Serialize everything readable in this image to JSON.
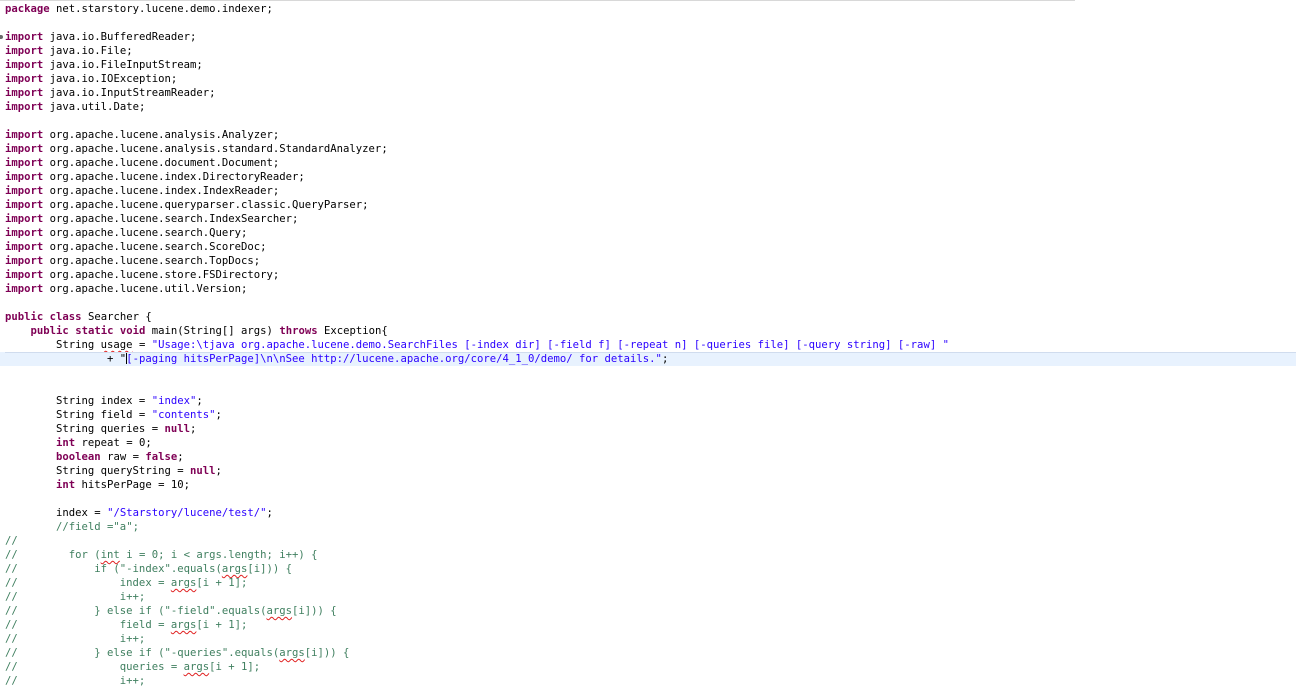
{
  "editor": {
    "lines": [
      {
        "folded": false,
        "tokens": [
          {
            "k": "kw",
            "t": "package"
          },
          {
            "k": "",
            "t": " net.starstory.lucene.demo.indexer;"
          }
        ]
      },
      {
        "tokens": []
      },
      {
        "folded": true,
        "tokens": [
          {
            "k": "kw",
            "t": "import"
          },
          {
            "k": "",
            "t": " java.io.BufferedReader;"
          }
        ]
      },
      {
        "tokens": [
          {
            "k": "kw",
            "t": "import"
          },
          {
            "k": "",
            "t": " java.io.File;"
          }
        ]
      },
      {
        "tokens": [
          {
            "k": "kw",
            "t": "import"
          },
          {
            "k": "",
            "t": " java.io.FileInputStream;"
          }
        ]
      },
      {
        "tokens": [
          {
            "k": "kw",
            "t": "import"
          },
          {
            "k": "",
            "t": " java.io.IOException;"
          }
        ]
      },
      {
        "tokens": [
          {
            "k": "kw",
            "t": "import"
          },
          {
            "k": "",
            "t": " java.io.InputStreamReader;"
          }
        ]
      },
      {
        "tokens": [
          {
            "k": "kw",
            "t": "import"
          },
          {
            "k": "",
            "t": " java.util.Date;"
          }
        ]
      },
      {
        "tokens": []
      },
      {
        "tokens": [
          {
            "k": "kw",
            "t": "import"
          },
          {
            "k": "",
            "t": " org.apache.lucene.analysis.Analyzer;"
          }
        ]
      },
      {
        "tokens": [
          {
            "k": "kw",
            "t": "import"
          },
          {
            "k": "",
            "t": " org.apache.lucene.analysis.standard.StandardAnalyzer;"
          }
        ]
      },
      {
        "tokens": [
          {
            "k": "kw",
            "t": "import"
          },
          {
            "k": "",
            "t": " org.apache.lucene.document.Document;"
          }
        ]
      },
      {
        "tokens": [
          {
            "k": "kw",
            "t": "import"
          },
          {
            "k": "",
            "t": " org.apache.lucene.index.DirectoryReader;"
          }
        ]
      },
      {
        "tokens": [
          {
            "k": "kw",
            "t": "import"
          },
          {
            "k": "",
            "t": " org.apache.lucene.index.IndexReader;"
          }
        ]
      },
      {
        "tokens": [
          {
            "k": "kw",
            "t": "import"
          },
          {
            "k": "",
            "t": " org.apache.lucene.queryparser.classic.QueryParser;"
          }
        ]
      },
      {
        "tokens": [
          {
            "k": "kw",
            "t": "import"
          },
          {
            "k": "",
            "t": " org.apache.lucene.search.IndexSearcher;"
          }
        ]
      },
      {
        "tokens": [
          {
            "k": "kw",
            "t": "import"
          },
          {
            "k": "",
            "t": " org.apache.lucene.search.Query;"
          }
        ]
      },
      {
        "tokens": [
          {
            "k": "kw",
            "t": "import"
          },
          {
            "k": "",
            "t": " org.apache.lucene.search.ScoreDoc;"
          }
        ]
      },
      {
        "tokens": [
          {
            "k": "kw",
            "t": "import"
          },
          {
            "k": "",
            "t": " org.apache.lucene.search.TopDocs;"
          }
        ]
      },
      {
        "tokens": [
          {
            "k": "kw",
            "t": "import"
          },
          {
            "k": "",
            "t": " org.apache.lucene.store.FSDirectory;"
          }
        ]
      },
      {
        "tokens": [
          {
            "k": "kw",
            "t": "import"
          },
          {
            "k": "",
            "t": " org.apache.lucene.util.Version;"
          }
        ]
      },
      {
        "tokens": []
      },
      {
        "tokens": [
          {
            "k": "kw",
            "t": "public"
          },
          {
            "k": "",
            "t": " "
          },
          {
            "k": "kw",
            "t": "class"
          },
          {
            "k": "",
            "t": " Searcher {"
          }
        ]
      },
      {
        "tokens": [
          {
            "k": "",
            "t": "    "
          },
          {
            "k": "kw",
            "t": "public"
          },
          {
            "k": "",
            "t": " "
          },
          {
            "k": "kw",
            "t": "static"
          },
          {
            "k": "",
            "t": " "
          },
          {
            "k": "kw",
            "t": "void"
          },
          {
            "k": "",
            "t": " main(String[] args) "
          },
          {
            "k": "kw",
            "t": "throws"
          },
          {
            "k": "",
            "t": " Exception{"
          }
        ]
      },
      {
        "tokens": [
          {
            "k": "",
            "t": "        String "
          },
          {
            "k": "warn",
            "t": "usage"
          },
          {
            "k": "",
            "t": " = "
          },
          {
            "k": "str",
            "t": "\"Usage:\\tjava org.apache.lucene.demo.SearchFiles [-index dir] [-field f] [-repeat n] [-queries file] [-query string] [-raw] \""
          }
        ]
      },
      {
        "current": true,
        "tokens": [
          {
            "k": "",
            "t": "                + \""
          },
          {
            "k": "caret",
            "t": ""
          },
          {
            "k": "str",
            "t": "[-paging hitsPerPage]\\n\\nSee http://lucene.apache.org/core/4_1_0/demo/ for details.\""
          },
          {
            "k": "",
            "t": ";"
          }
        ]
      },
      {
        "tokens": []
      },
      {
        "tokens": []
      },
      {
        "tokens": [
          {
            "k": "",
            "t": "        String index = "
          },
          {
            "k": "str",
            "t": "\"index\""
          },
          {
            "k": "",
            "t": ";"
          }
        ]
      },
      {
        "tokens": [
          {
            "k": "",
            "t": "        String field = "
          },
          {
            "k": "str",
            "t": "\"contents\""
          },
          {
            "k": "",
            "t": ";"
          }
        ]
      },
      {
        "tokens": [
          {
            "k": "",
            "t": "        String queries = "
          },
          {
            "k": "kw",
            "t": "null"
          },
          {
            "k": "",
            "t": ";"
          }
        ]
      },
      {
        "tokens": [
          {
            "k": "",
            "t": "        "
          },
          {
            "k": "kw",
            "t": "int"
          },
          {
            "k": "",
            "t": " repeat = 0;"
          }
        ]
      },
      {
        "tokens": [
          {
            "k": "",
            "t": "        "
          },
          {
            "k": "kw",
            "t": "boolean"
          },
          {
            "k": "",
            "t": " raw = "
          },
          {
            "k": "kw",
            "t": "false"
          },
          {
            "k": "",
            "t": ";"
          }
        ]
      },
      {
        "tokens": [
          {
            "k": "",
            "t": "        String queryString = "
          },
          {
            "k": "kw",
            "t": "null"
          },
          {
            "k": "",
            "t": ";"
          }
        ]
      },
      {
        "tokens": [
          {
            "k": "",
            "t": "        "
          },
          {
            "k": "kw",
            "t": "int"
          },
          {
            "k": "",
            "t": " hitsPerPage = 10;"
          }
        ]
      },
      {
        "tokens": []
      },
      {
        "tokens": [
          {
            "k": "",
            "t": "        index = "
          },
          {
            "k": "str",
            "t": "\"/Starstory/lucene/test/\""
          },
          {
            "k": "",
            "t": ";"
          }
        ]
      },
      {
        "tokens": [
          {
            "k": "",
            "t": "        "
          },
          {
            "k": "cm",
            "t": "//field =\"a\";"
          }
        ]
      },
      {
        "tokens": [
          {
            "k": "cm",
            "t": "//"
          }
        ]
      },
      {
        "tokens": [
          {
            "k": "cm",
            "t": "//        for ("
          },
          {
            "k": "cm warn",
            "t": "int"
          },
          {
            "k": "cm",
            "t": " i = 0; i < args.length; i++) {"
          }
        ]
      },
      {
        "tokens": [
          {
            "k": "cm",
            "t": "//            if (\"-index\".equals("
          },
          {
            "k": "cm warn",
            "t": "args"
          },
          {
            "k": "cm",
            "t": "[i])) {"
          }
        ]
      },
      {
        "tokens": [
          {
            "k": "cm",
            "t": "//                index = "
          },
          {
            "k": "cm warn",
            "t": "args"
          },
          {
            "k": "cm",
            "t": "[i + 1];"
          }
        ]
      },
      {
        "tokens": [
          {
            "k": "cm",
            "t": "//                i++;"
          }
        ]
      },
      {
        "tokens": [
          {
            "k": "cm",
            "t": "//            } else if (\"-field\".equals("
          },
          {
            "k": "cm warn",
            "t": "args"
          },
          {
            "k": "cm",
            "t": "[i])) {"
          }
        ]
      },
      {
        "tokens": [
          {
            "k": "cm",
            "t": "//                field = "
          },
          {
            "k": "cm warn",
            "t": "args"
          },
          {
            "k": "cm",
            "t": "[i + 1];"
          }
        ]
      },
      {
        "tokens": [
          {
            "k": "cm",
            "t": "//                i++;"
          }
        ]
      },
      {
        "tokens": [
          {
            "k": "cm",
            "t": "//            } else if (\"-queries\".equals("
          },
          {
            "k": "cm warn",
            "t": "args"
          },
          {
            "k": "cm",
            "t": "[i])) {"
          }
        ]
      },
      {
        "tokens": [
          {
            "k": "cm",
            "t": "//                queries = "
          },
          {
            "k": "cm warn",
            "t": "args"
          },
          {
            "k": "cm",
            "t": "[i + 1];"
          }
        ]
      },
      {
        "tokens": [
          {
            "k": "cm",
            "t": "//                i++;"
          }
        ]
      }
    ]
  },
  "colors": {
    "keyword": "#7f0055",
    "string": "#2a00ff",
    "comment": "#3f7f5f",
    "current_line": "#e8f2fe",
    "warning_underline": "#e02020"
  }
}
